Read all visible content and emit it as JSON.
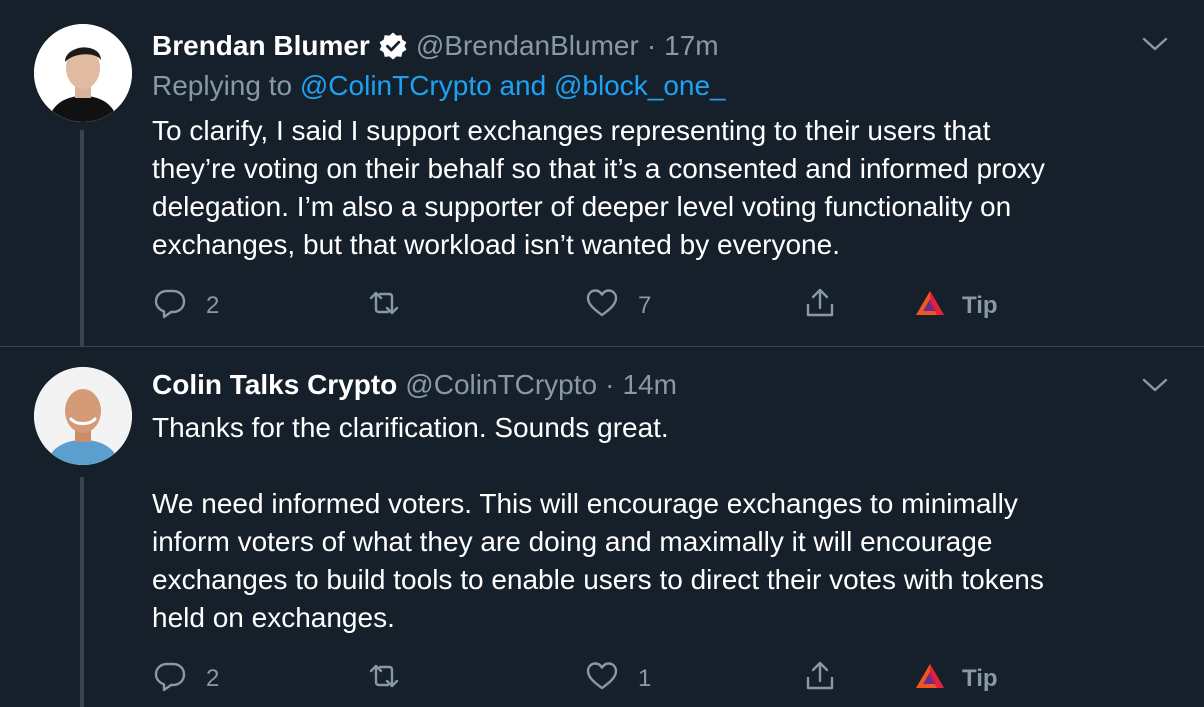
{
  "tweets": [
    {
      "author": {
        "display_name": "Brendan Blumer",
        "verified": true,
        "handle": "@BrendanBlumer"
      },
      "separator": "·",
      "time": "17m",
      "replying": {
        "prefix": "Replying to ",
        "mentions": "@ColinTCrypto and @block_one_"
      },
      "text": "To clarify, I said I support exchanges representing to their users that\nthey’re voting on their behalf so that it’s a consented and informed proxy\ndelegation. I’m also a supporter of deeper level voting functionality on\nexchanges, but that workload isn’t wanted by everyone.",
      "actions": {
        "reply_count": "2",
        "retweet_count": "",
        "like_count": "7",
        "tip_label": "Tip"
      }
    },
    {
      "author": {
        "display_name": "Colin Talks Crypto",
        "verified": false,
        "handle": "@ColinTCrypto"
      },
      "separator": "·",
      "time": "14m",
      "text": "Thanks for the clarification. Sounds great.\n\nWe need informed voters. This will encourage exchanges to minimally\ninform voters of what they are doing and maximally it will encourage\nexchanges to build tools to enable users to direct their votes with tokens\nheld on exchanges.",
      "actions": {
        "reply_count": "2",
        "retweet_count": "",
        "like_count": "1",
        "tip_label": "Tip"
      }
    }
  ],
  "icons": {
    "verified": "verified-badge-icon",
    "chevron": "chevron-down-icon",
    "reply": "reply-bubble-icon",
    "retweet": "retweet-icon",
    "like": "heart-icon",
    "share": "share-icon",
    "tip": "brave-tip-icon"
  },
  "colors": {
    "background": "#15202b",
    "text": "#ffffff",
    "muted": "#8899a6",
    "link": "#1da1f2",
    "divider": "#38444d"
  }
}
